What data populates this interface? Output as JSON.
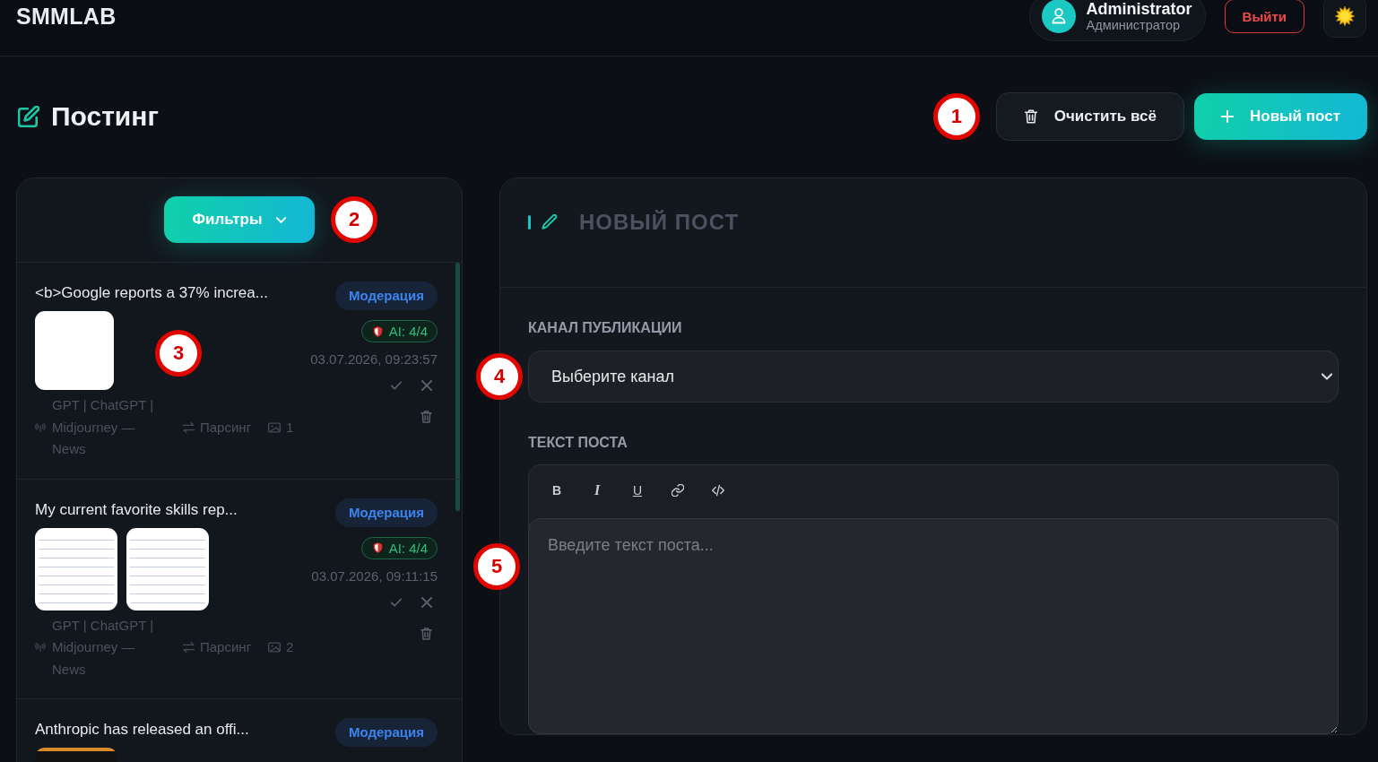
{
  "header": {
    "logo": "SMMLAB",
    "user": {
      "name": "Administrator",
      "role": "Администратор"
    },
    "logout": "Выйти"
  },
  "page": {
    "title": "Постинг",
    "callout": "1",
    "actions": [
      {
        "kind": "clear",
        "label": "Очистить всё"
      },
      {
        "kind": "create",
        "label": "Новый пост"
      }
    ]
  },
  "filters": {
    "label": "Фильтры",
    "expanded": false,
    "callout": "2"
  },
  "posts": [
    {
      "title": "<b>Google reports a 37% increa...",
      "status": "Модерация",
      "thumbnails": [
        {
          "kind": "text"
        }
      ],
      "ai": "AI: 4/4",
      "date": "03.07.2026, 09:23:57",
      "channel": "GPT | ChatGPT | Midjourney — News",
      "source": "Парсинг",
      "image_count": "1",
      "callout": "3"
    },
    {
      "title": "My current favorite skills rep...",
      "status": "Модерация",
      "thumbnails": [
        {
          "kind": "document"
        },
        {
          "kind": "document"
        }
      ],
      "ai": "AI: 4/4",
      "date": "03.07.2026, 09:11:15",
      "channel": "GPT | ChatGPT | Midjourney — News",
      "source": "Парсинг",
      "image_count": "2"
    },
    {
      "title": "Anthropic has released an offi...",
      "status": "Модерация",
      "thumbnails": [
        {
          "kind": "dark"
        }
      ]
    }
  ],
  "editor": {
    "title": "НОВЫЙ ПОСТ",
    "channel_label": "КАНАЛ ПУБЛИКАЦИИ",
    "channel_select": {
      "value": "Выберите канал",
      "callout": "4"
    },
    "text_label": "ТЕКСТ ПОСТА",
    "toolbar": [
      {
        "kind": "bold",
        "label": "B"
      },
      {
        "kind": "italic",
        "label": "I"
      },
      {
        "kind": "underline",
        "label": "U"
      },
      {
        "kind": "link"
      },
      {
        "kind": "code"
      }
    ],
    "text_field": {
      "placeholder": "Введите текст поста...",
      "callout": "5"
    }
  }
}
